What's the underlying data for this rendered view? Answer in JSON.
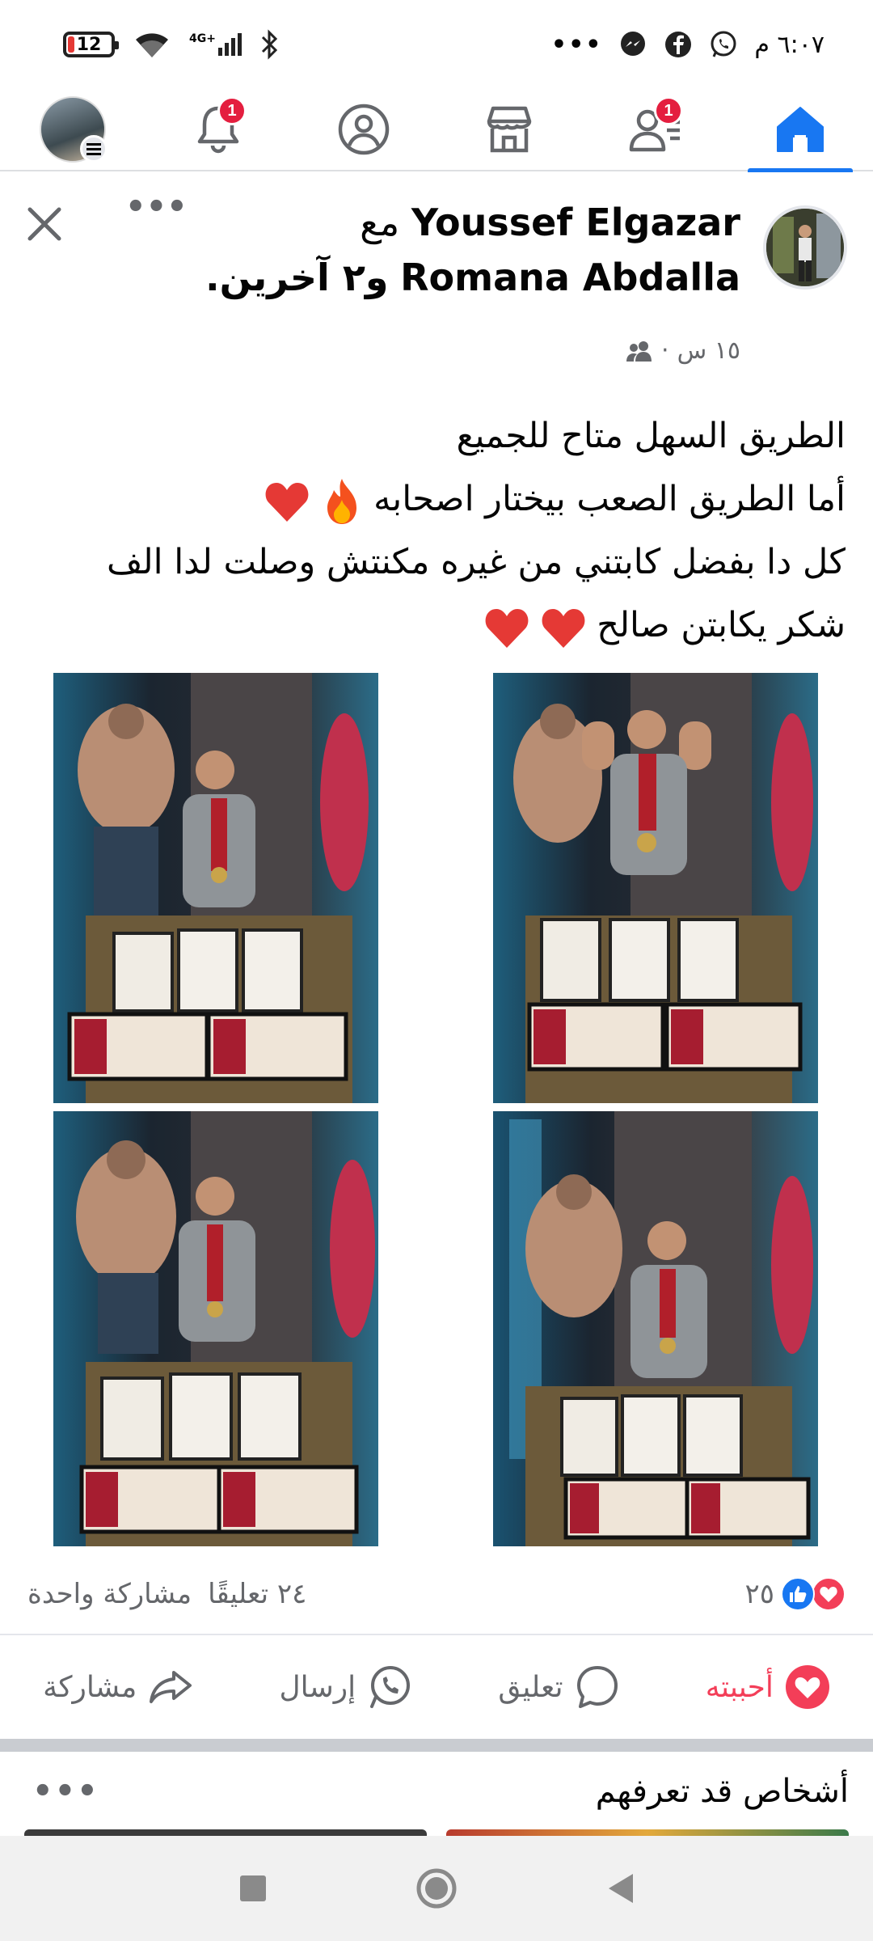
{
  "status_bar": {
    "battery": "12",
    "network": "4G+",
    "time": "٦:٠٧ م",
    "more": "•••"
  },
  "top_nav": {
    "notifications_badge": "1",
    "friends_badge": "1",
    "accent": "#1877f2",
    "badge_color": "#e41e3f"
  },
  "post": {
    "author": "Youssef Elgazar",
    "with_word": "مع",
    "tagged": "Romana Abdalla",
    "and_others": "و٢ آخرين.",
    "time": "١٥ س",
    "separator": "·",
    "more": "•••",
    "text_lines": [
      "الطريق السهل متاح للجميع",
      "أما الطريق الصعب بيختار اصحابه",
      "كل دا بفضل كابتني من غيره مكنتش وصلت لدا الف",
      "شكر يكابتن صالح"
    ],
    "reactions_count": "٢٥",
    "comments": "٢٤ تعليقًا",
    "shares": "مشاركة واحدة",
    "love_color": "#f33e58"
  },
  "actions": {
    "like": "أحببته",
    "comment": "تعليق",
    "send": "إرسال",
    "share": "مشاركة"
  },
  "pymk": {
    "title": "أشخاص قد تعرفهم",
    "more": "•••"
  }
}
